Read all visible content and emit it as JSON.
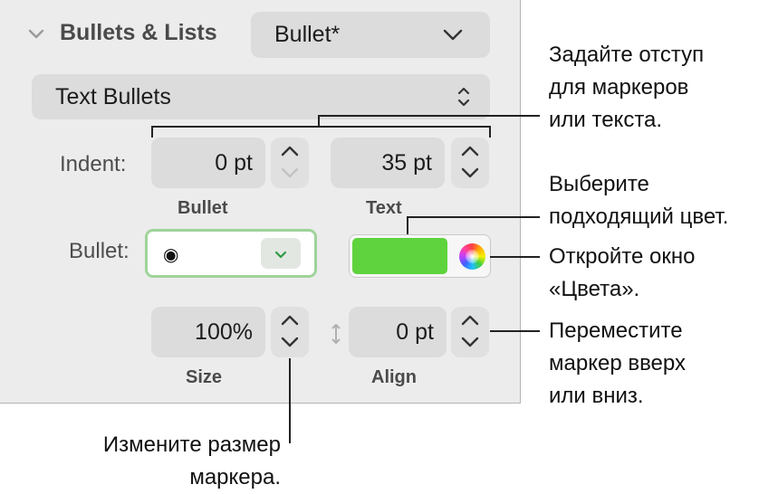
{
  "section": {
    "title": "Bullets & Lists",
    "preset_value": "Bullet*",
    "list_type_value": "Text Bullets"
  },
  "indent": {
    "label": "Indent:",
    "bullet_value": "0 pt",
    "text_value": "35 pt",
    "bullet_caption": "Bullet",
    "text_caption": "Text"
  },
  "bullet": {
    "label": "Bullet:",
    "marker": "◉",
    "color_hex": "#5ed33d"
  },
  "size": {
    "value": "100%",
    "caption": "Size"
  },
  "align": {
    "value": "0 pt",
    "caption": "Align"
  },
  "callouts": {
    "indent": [
      "Задайте отступ",
      "для маркеров",
      "или текста."
    ],
    "color": [
      "Выберите",
      "подходящий цвет."
    ],
    "colors_window": [
      "Откройте окно",
      "«Цвета»."
    ],
    "move": [
      "Переместите",
      "маркер вверх",
      "или вниз."
    ],
    "size": [
      "Измените размер",
      "маркера."
    ]
  }
}
